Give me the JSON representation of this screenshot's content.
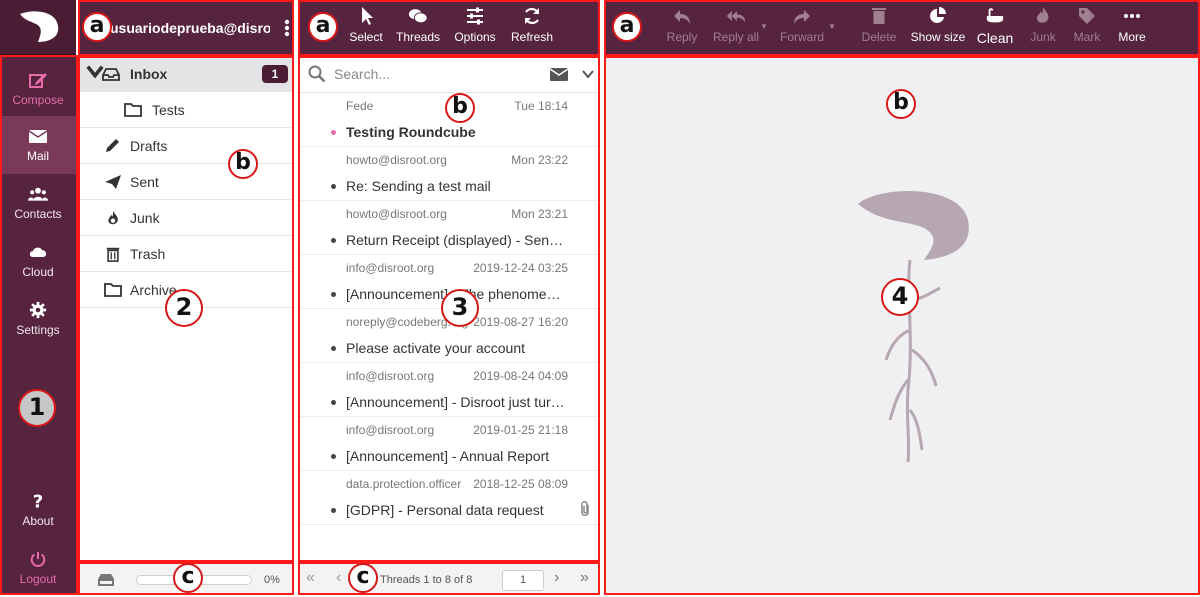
{
  "nav": {
    "compose": "Compose",
    "mail": "Mail",
    "contacts": "Contacts",
    "cloud": "Cloud",
    "settings": "Settings",
    "about": "About",
    "logout": "Logout"
  },
  "account": {
    "username": "usuariodeprueba@disroot..."
  },
  "folders": [
    {
      "label": "Inbox",
      "count": "1"
    },
    {
      "label": "Tests"
    },
    {
      "label": "Drafts"
    },
    {
      "label": "Sent"
    },
    {
      "label": "Junk"
    },
    {
      "label": "Trash"
    },
    {
      "label": "Archive"
    }
  ],
  "quota": {
    "percent_label": "0%",
    "used_fraction": 0
  },
  "msg_toolbar": {
    "select": "Select",
    "threads": "Threads",
    "options": "Options",
    "refresh": "Refresh"
  },
  "search": {
    "placeholder": "Search..."
  },
  "messages": [
    {
      "from": "Fede",
      "date": "Tue 18:14",
      "subject": "Testing Roundcube",
      "unread": true
    },
    {
      "from": "howto@disroot.org",
      "date": "Mon 23:22",
      "subject": "Re: Sending a test mail",
      "unread": false
    },
    {
      "from": "howto@disroot.org",
      "date": "Mon 23:21",
      "subject": "Return Receipt (displayed) - Sending a test mail",
      "unread": false
    },
    {
      "from": "info@disroot.org",
      "date": "2019-12-24 03:25",
      "subject": "[Announcement] - The phenomenon",
      "unread": false
    },
    {
      "from": "noreply@codeberg.org",
      "date": "2019-08-27 16:20",
      "subject": "Please activate your account",
      "unread": false
    },
    {
      "from": "info@disroot.org",
      "date": "2019-08-24 04:09",
      "subject": "[Announcement] - Disroot just turned",
      "unread": false
    },
    {
      "from": "info@disroot.org",
      "date": "2019-01-25 21:18",
      "subject": "[Announcement] - Annual Report",
      "unread": false
    },
    {
      "from": "data.protection.officer",
      "date": "2018-12-25 08:09",
      "subject": "[GDPR] - Personal data request",
      "unread": false,
      "attachment": true
    }
  ],
  "pagination": {
    "label": "Threads 1 to 8 of 8",
    "page": "1"
  },
  "preview_toolbar": {
    "reply": "Reply",
    "reply_all": "Reply all",
    "forward": "Forward",
    "delete": "Delete",
    "show_size": "Show size",
    "clean": "Clean",
    "junk": "Junk",
    "mark": "Mark",
    "more": "More"
  },
  "annotations": {
    "a": "a",
    "b": "b",
    "c": "c",
    "n1": "1",
    "n2": "2",
    "n3": "3",
    "n4": "4"
  },
  "colors": {
    "toolbar_bg": "#57243f",
    "active_nav": "#7a3959",
    "accent_pink": "#e66caa",
    "annotation_red": "#ff1a1a"
  }
}
